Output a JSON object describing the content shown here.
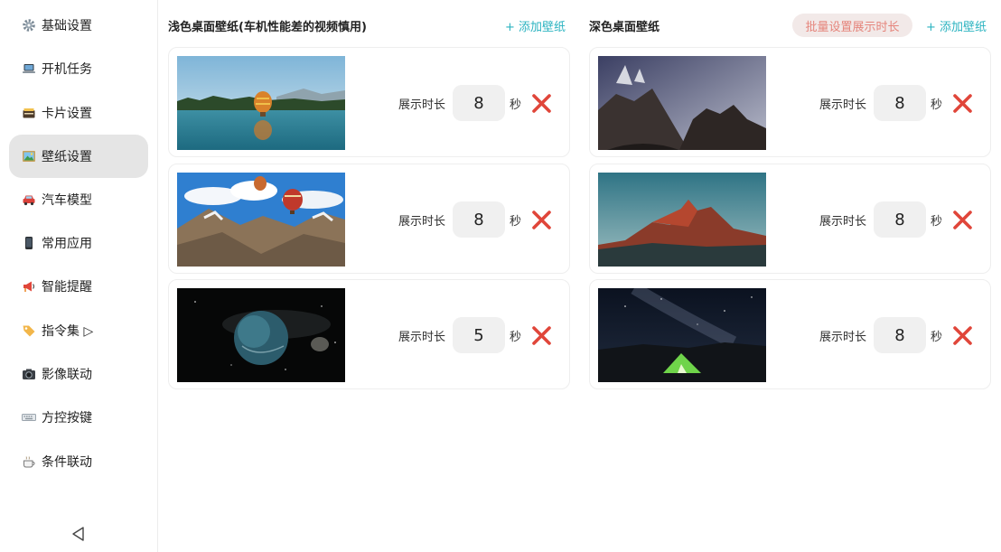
{
  "sidebar": {
    "items": [
      {
        "label": "基础设置",
        "icon": "gear-icon"
      },
      {
        "label": "开机任务",
        "icon": "laptop-icon"
      },
      {
        "label": "卡片设置",
        "icon": "card-box-icon"
      },
      {
        "label": "壁纸设置",
        "icon": "picture-icon",
        "active": true
      },
      {
        "label": "汽车模型",
        "icon": "car-icon"
      },
      {
        "label": "常用应用",
        "icon": "phone-icon"
      },
      {
        "label": "智能提醒",
        "icon": "megaphone-icon"
      },
      {
        "label": "指令集 ▷",
        "icon": "tag-icon"
      },
      {
        "label": "影像联动",
        "icon": "camera-icon"
      },
      {
        "label": "方控按键",
        "icon": "keyboard-icon"
      },
      {
        "label": "条件联动",
        "icon": "coffee-icon"
      }
    ],
    "back_icon": "back-triangle-icon"
  },
  "light": {
    "title": "浅色桌面壁纸(车机性能差的视频慎用)",
    "add_label": "+ 添加壁纸",
    "cards": [
      {
        "image": "lake-balloon",
        "duration_label": "展示时长",
        "duration": "8",
        "unit": "秒"
      },
      {
        "image": "mountain-balloons",
        "duration_label": "展示时长",
        "duration": "8",
        "unit": "秒"
      },
      {
        "image": "planet-space",
        "duration_label": "展示时长",
        "duration": "5",
        "unit": "秒"
      }
    ]
  },
  "dark": {
    "title": "深色桌面壁纸",
    "batch_label": "批量设置展示时长",
    "add_label": "+ 添加壁纸",
    "cards": [
      {
        "image": "dark-peaks",
        "duration_label": "展示时长",
        "duration": "8",
        "unit": "秒"
      },
      {
        "image": "red-mountain-dusk",
        "duration_label": "展示时长",
        "duration": "8",
        "unit": "秒"
      },
      {
        "image": "milky-way-tent",
        "duration_label": "展示时长",
        "duration": "8",
        "unit": "秒"
      }
    ]
  },
  "colors": {
    "accent": "#2bb3c0",
    "delete": "#e0463a",
    "batch_text": "#e5857c",
    "batch_bg": "#f2e9e8",
    "active_nav": "#e5e5e5"
  }
}
